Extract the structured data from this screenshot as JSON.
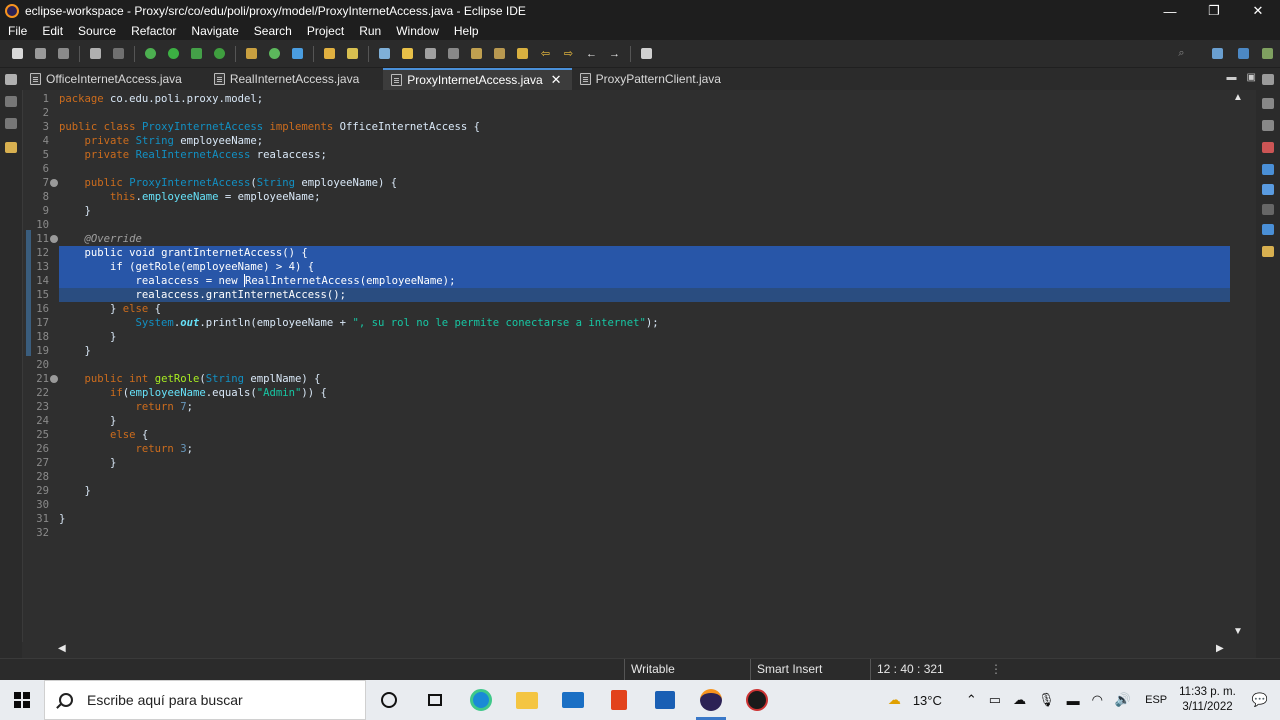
{
  "window": {
    "title": "eclipse-workspace - Proxy/src/co/edu/poli/proxy/model/ProxyInternetAccess.java - Eclipse IDE",
    "minimize": "—",
    "restore": "❐",
    "close": "✕"
  },
  "menu": [
    "File",
    "Edit",
    "Source",
    "Refactor",
    "Navigate",
    "Search",
    "Project",
    "Run",
    "Window",
    "Help"
  ],
  "tabs": [
    {
      "label": "OfficeInternetAccess.java",
      "active": false
    },
    {
      "label": "RealInternetAccess.java",
      "active": false
    },
    {
      "label": "ProxyInternetAccess.java",
      "active": true
    },
    {
      "label": "ProxyPatternClient.java",
      "active": false
    }
  ],
  "tab_close": "✕",
  "editor": {
    "line_numbers": [
      "1",
      "2",
      "3",
      "4",
      "5",
      "6",
      "7",
      "8",
      "9",
      "10",
      "11",
      "12",
      "13",
      "14",
      "15",
      "16",
      "17",
      "18",
      "19",
      "20",
      "21",
      "22",
      "23",
      "24",
      "25",
      "26",
      "27",
      "28",
      "29",
      "30",
      "31",
      "32"
    ],
    "string_a": "\", su rol no le permite conectarse a internet\"",
    "string_admin": "\"Admin\"",
    "num_4": "4",
    "num_7": "7",
    "num_3": "3"
  },
  "status": {
    "writable": "Writable",
    "insert_mode": "Smart Insert",
    "position": "12 : 40 : 321"
  },
  "taskbar": {
    "search_placeholder": "Escribe aquí para buscar",
    "weather": "13°C",
    "language": "ESP",
    "time": "11:33 p. m.",
    "date": "3/11/2022"
  },
  "colors": {
    "selection": "#2856a8",
    "keyword": "#cc6c1d",
    "type": "#1290c3",
    "field": "#66e1f8",
    "string": "#17c6a3"
  }
}
